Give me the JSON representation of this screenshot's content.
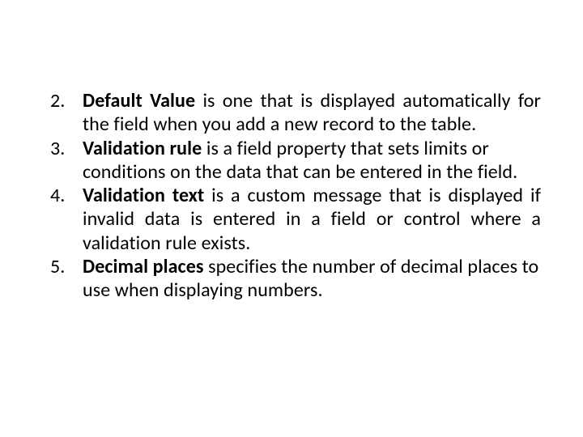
{
  "items": [
    {
      "term": "Default Value",
      "rest": " is one that is displayed automatically for the field when you add a new record to the table."
    },
    {
      "term": "Validation rule",
      "rest": " is a field property that sets limits or conditions on the data that can be entered in the field."
    },
    {
      "term": "Validation text",
      "rest": " is a custom message that is displayed if invalid data is entered in a field or control where a validation rule exists."
    },
    {
      "term": "Decimal places",
      "rest": " specifies the number of decimal places to use when displaying numbers."
    }
  ]
}
